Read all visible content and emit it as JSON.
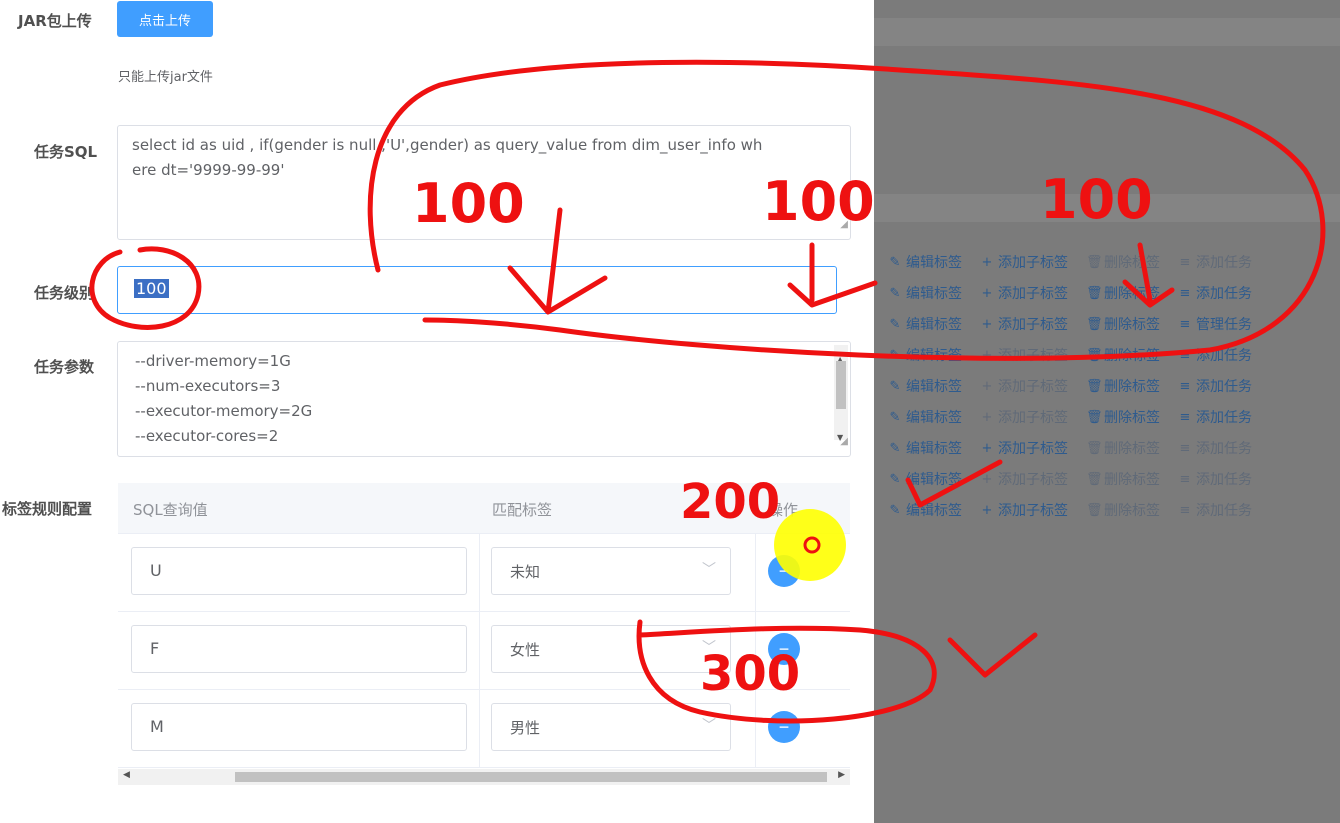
{
  "form": {
    "jar_label": "JAR包上传",
    "upload_button": "点击上传",
    "upload_tip": "只能上传jar文件",
    "sql_label": "任务SQL",
    "sql_line1": "select  id  as uid , if(gender is null ,'U',gender)  as query_value  from dim_user_info wh",
    "sql_line2": "ere dt='9999-99-99'",
    "level_label": "任务级别",
    "level_value": "100",
    "params_label": "任务参数",
    "params": [
      "--driver-memory=1G",
      "--num-executors=3",
      "--executor-memory=2G",
      "--executor-cores=2"
    ],
    "rule_label": "标签规则配置"
  },
  "rule_table": {
    "headers": [
      "SQL查询值",
      "匹配标签",
      "操作"
    ],
    "rows": [
      {
        "query_value": "U",
        "tag": "未知"
      },
      {
        "query_value": "F",
        "tag": "女性"
      },
      {
        "query_value": "M",
        "tag": "男性"
      }
    ]
  },
  "background_ops": {
    "labels": [
      "编辑标签",
      "添加子标签",
      "删除标签",
      "添加任务",
      "管理任务"
    ],
    "icons": [
      "edit-icon",
      "plus-icon",
      "trash-icon",
      "list-icon"
    ]
  },
  "annotations": {
    "note_a": "100",
    "note_b": "100",
    "note_c": "100",
    "note_d": "200",
    "note_e": "300"
  },
  "colors": {
    "primary": "#409eff",
    "annotation": "#ee1111",
    "mask": "#7b7b7b",
    "cursor_highlight": "#ffff00"
  }
}
